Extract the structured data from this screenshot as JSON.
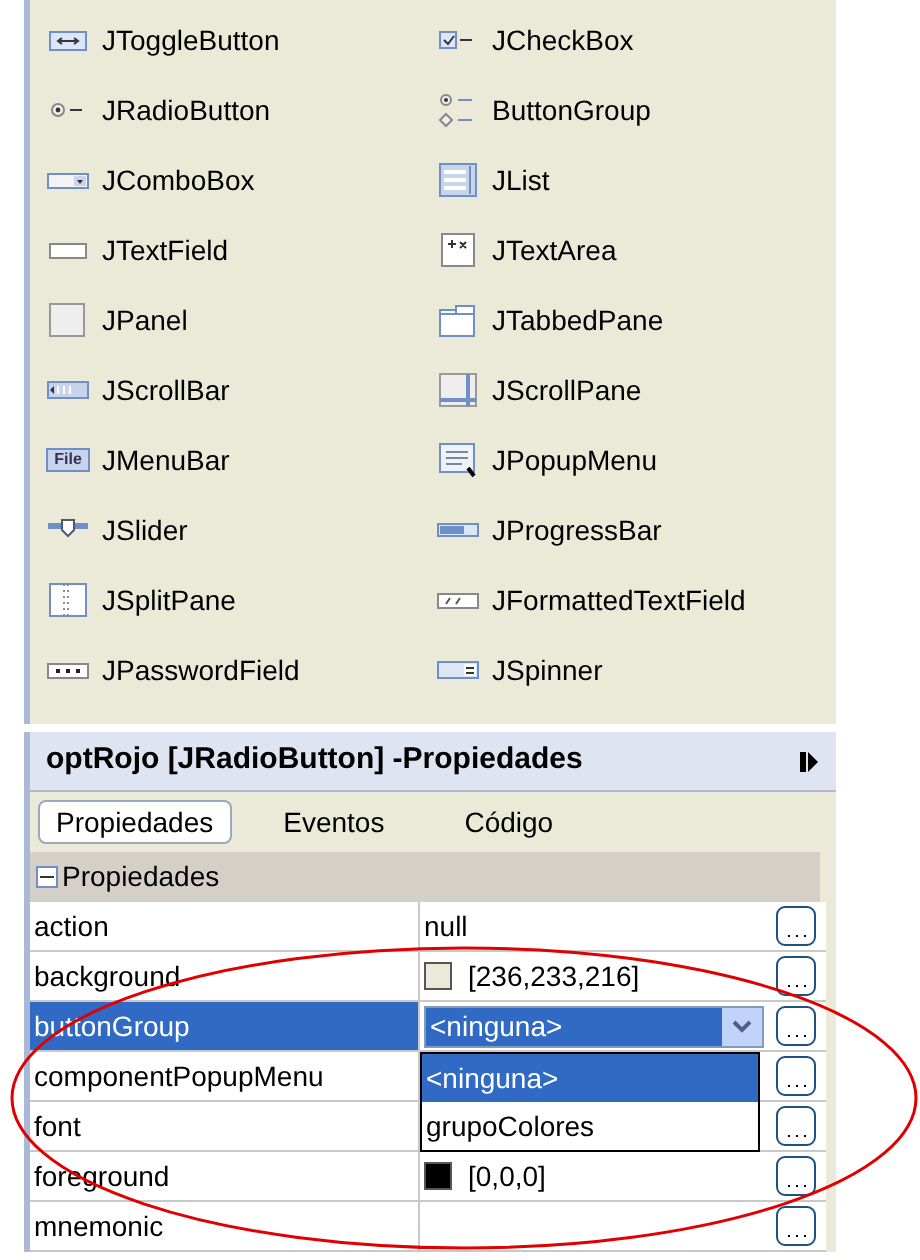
{
  "palette": {
    "items": [
      {
        "label": "JToggleButton"
      },
      {
        "label": "JCheckBox"
      },
      {
        "label": "JRadioButton"
      },
      {
        "label": "ButtonGroup"
      },
      {
        "label": "JComboBox"
      },
      {
        "label": "JList"
      },
      {
        "label": "JTextField"
      },
      {
        "label": "JTextArea"
      },
      {
        "label": "JPanel"
      },
      {
        "label": "JTabbedPane"
      },
      {
        "label": "JScrollBar"
      },
      {
        "label": "JScrollPane"
      },
      {
        "label": "JMenuBar",
        "icon_text": "File"
      },
      {
        "label": "JPopupMenu"
      },
      {
        "label": "JSlider"
      },
      {
        "label": "JProgressBar"
      },
      {
        "label": "JSplitPane"
      },
      {
        "label": "JFormattedTextField"
      },
      {
        "label": "JPasswordField"
      },
      {
        "label": "JSpinner"
      }
    ]
  },
  "properties_panel": {
    "title": "optRojo [JRadioButton] -Propiedades",
    "tabs": [
      {
        "label": "Propiedades",
        "selected": true
      },
      {
        "label": "Eventos",
        "selected": false
      },
      {
        "label": "Código",
        "selected": false
      }
    ],
    "section": {
      "label": "Propiedades",
      "expanded": true
    },
    "rows": [
      {
        "name": "action",
        "value": "null",
        "selected": false,
        "kind": "text"
      },
      {
        "name": "background",
        "value": "[236,233,216]",
        "color": "#ece9d8",
        "selected": false,
        "kind": "color"
      },
      {
        "name": "buttonGroup",
        "value": "<ninguna>",
        "selected": true,
        "kind": "combo",
        "options": [
          {
            "label": "<ninguna>",
            "selected": true
          },
          {
            "label": "grupoColores",
            "selected": false
          }
        ]
      },
      {
        "name": "componentPopupMenu",
        "selected": false,
        "kind": "text"
      },
      {
        "name": "font",
        "selected": false,
        "kind": "text"
      },
      {
        "name": "foreground",
        "value": "[0,0,0]",
        "color": "#000000",
        "selected": false,
        "kind": "color"
      },
      {
        "name": "mnemonic",
        "selected": false,
        "kind": "text"
      }
    ]
  }
}
